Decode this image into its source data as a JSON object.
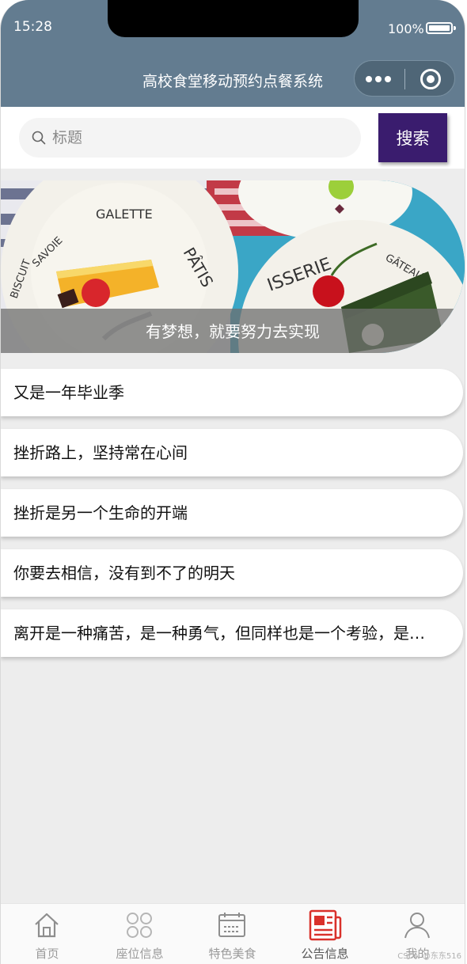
{
  "status_bar": {
    "time": "15:28",
    "battery": "100%"
  },
  "nav": {
    "title": "高校食堂移动预约点餐系统",
    "menu_icon": "more-dots-icon",
    "close_icon": "target-circle-icon"
  },
  "search": {
    "placeholder": "标题",
    "button_label": "搜索",
    "icon": "search-icon"
  },
  "banner": {
    "caption": "有梦想，就要努力去实现",
    "plate_text_left": "BISCUIT SAVOIE GALETTE PÂTISSERIE",
    "plate_text_right": "PÂTISSERIE GÂTEAU"
  },
  "notices": [
    {
      "title": "又是一年毕业季"
    },
    {
      "title": "挫折路上，坚持常在心间"
    },
    {
      "title": "挫折是另一个生命的开端"
    },
    {
      "title": "你要去相信，没有到不了的明天"
    },
    {
      "title": "离开是一种痛苦，是一种勇气，但同样也是一个考验，是…"
    }
  ],
  "tabbar": {
    "items": [
      {
        "label": "首页",
        "icon": "home-icon"
      },
      {
        "label": "座位信息",
        "icon": "seat-grid-icon"
      },
      {
        "label": "特色美食",
        "icon": "calendar-icon"
      },
      {
        "label": "公告信息",
        "icon": "news-icon",
        "active": true
      },
      {
        "label": "我的",
        "icon": "user-icon"
      }
    ]
  },
  "watermark": "CSDN @东东516",
  "colors": {
    "nav_bg": "#637c90",
    "search_button": "#3a1c6e",
    "active_tab_icon": "#d9312b",
    "page_bg": "#ededed"
  }
}
